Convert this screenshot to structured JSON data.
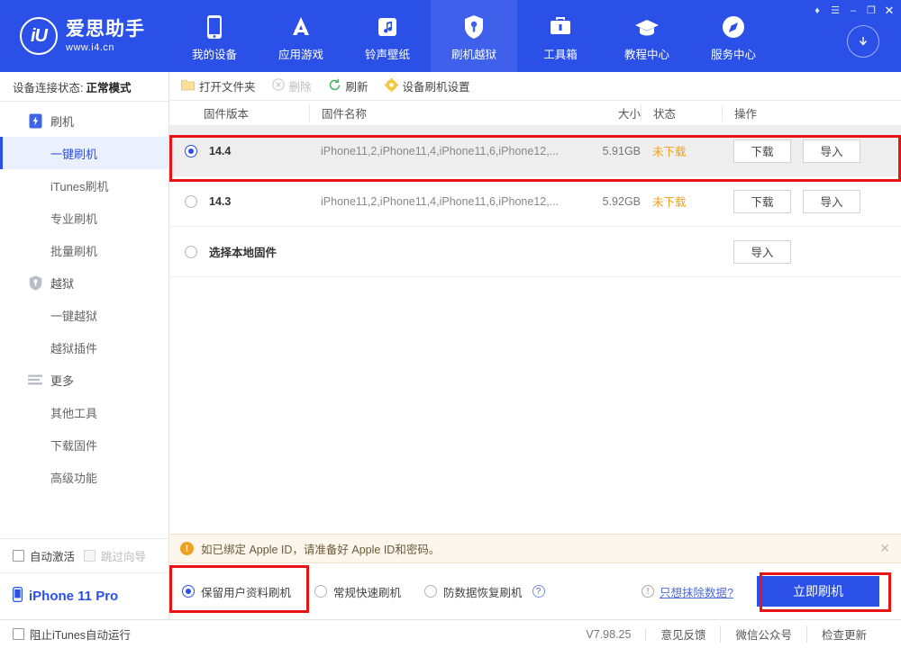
{
  "header": {
    "logo": {
      "mark": "iU",
      "name": "爱思助手",
      "url": "www.i4.cn"
    },
    "nav": [
      {
        "label": "我的设备",
        "icon": "phone-icon"
      },
      {
        "label": "应用游戏",
        "icon": "appstore-icon"
      },
      {
        "label": "铃声壁纸",
        "icon": "music-icon"
      },
      {
        "label": "刷机越狱",
        "icon": "flash-jailbreak-icon"
      },
      {
        "label": "工具箱",
        "icon": "toolbox-icon"
      },
      {
        "label": "教程中心",
        "icon": "graduation-cap-icon"
      },
      {
        "label": "服务中心",
        "icon": "compass-icon"
      }
    ],
    "active_nav_index": 3,
    "window_buttons": [
      {
        "name": "skin-icon",
        "glyph": "♦"
      },
      {
        "name": "menu-icon",
        "glyph": "☰"
      },
      {
        "name": "minimize-icon",
        "glyph": "–"
      },
      {
        "name": "maximize-icon",
        "glyph": "❐"
      },
      {
        "name": "close-icon",
        "glyph": "✕"
      }
    ],
    "download_icon": "download-circle-icon"
  },
  "sidebar": {
    "connection_label": "设备连接状态:",
    "connection_value": "正常模式",
    "items": [
      {
        "label": "刷机",
        "type": "group",
        "icon": "flash-icon",
        "selected": false
      },
      {
        "label": "一键刷机",
        "type": "child",
        "selected": true
      },
      {
        "label": "iTunes刷机",
        "type": "child",
        "selected": false
      },
      {
        "label": "专业刷机",
        "type": "child",
        "selected": false
      },
      {
        "label": "批量刷机",
        "type": "child",
        "selected": false
      },
      {
        "label": "越狱",
        "type": "group",
        "icon": "jailbreak-icon",
        "selected": false
      },
      {
        "label": "一键越狱",
        "type": "child",
        "selected": false
      },
      {
        "label": "越狱插件",
        "type": "child",
        "selected": false
      },
      {
        "label": "更多",
        "type": "group",
        "icon": "more-lines-icon",
        "selected": false
      },
      {
        "label": "其他工具",
        "type": "child",
        "selected": false
      },
      {
        "label": "下载固件",
        "type": "child",
        "selected": false
      },
      {
        "label": "高级功能",
        "type": "child",
        "selected": false
      }
    ],
    "auto_activate": {
      "label": "自动激活",
      "checked": false
    },
    "skip_guide": {
      "label": "跳过向导",
      "checked": false,
      "disabled": true
    },
    "device": {
      "label": "iPhone 11 Pro",
      "icon": "phone-small-icon"
    }
  },
  "toolbar": {
    "open_folder": "打开文件夹",
    "delete": "删除",
    "refresh": "刷新",
    "device_flash_settings": "设备刷机设置"
  },
  "table": {
    "columns": [
      "固件版本",
      "固件名称",
      "大小",
      "状态",
      "操作"
    ],
    "rows": [
      {
        "version": "14.4",
        "name": "iPhone11,2,iPhone11,4,iPhone11,6,iPhone12,...",
        "size": "5.91GB",
        "status": "未下载",
        "download": "下载",
        "import": "导入",
        "selected": true,
        "highlighted": true
      },
      {
        "version": "14.3",
        "name": "iPhone11,2,iPhone11,4,iPhone11,6,iPhone12,...",
        "size": "5.92GB",
        "status": "未下载",
        "download": "下载",
        "import": "导入",
        "selected": false,
        "highlighted": false
      }
    ],
    "local_row": {
      "label": "选择本地固件",
      "import": "导入",
      "selected": false
    }
  },
  "notice": {
    "text": "如已绑定 Apple ID，请准备好 Apple ID和密码。",
    "close": "✕"
  },
  "actions": {
    "options": [
      {
        "label": "保留用户资料刷机",
        "selected": true
      },
      {
        "label": "常规快速刷机",
        "selected": false
      },
      {
        "label": "防数据恢复刷机",
        "selected": false,
        "help": "?"
      }
    ],
    "erase_link": "只想抹除数据?",
    "flash_button": "立即刷机"
  },
  "statusbar": {
    "block_itunes": {
      "label": "阻止iTunes自动运行",
      "checked": false
    },
    "version": "V7.98.25",
    "links": [
      "意见反馈",
      "微信公众号",
      "检查更新"
    ]
  },
  "colors": {
    "brand_blue": "#2b50e8",
    "highlight_red": "#e81313",
    "status_orange": "#f0a020",
    "notice_bg": "#fdf6ec"
  }
}
